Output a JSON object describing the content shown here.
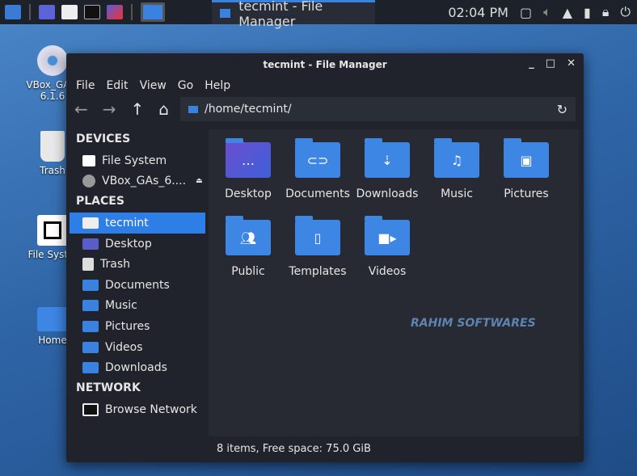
{
  "panel": {
    "task_title": "tecmint - File Manager",
    "clock": "02:04 PM"
  },
  "desktop": {
    "icons": [
      {
        "label": "VBox_GA...",
        "sub": "6.1.6"
      },
      {
        "label": "Trash"
      },
      {
        "label": "File Syst..."
      },
      {
        "label": "Home"
      }
    ]
  },
  "window": {
    "title": "tecmint - File Manager",
    "controls": [
      "_",
      "□",
      "✕"
    ],
    "menu": [
      "File",
      "Edit",
      "View",
      "Go",
      "Help"
    ],
    "address": "/home/tecmint/",
    "sidebar": {
      "devices_header": "DEVICES",
      "devices": [
        "File System",
        "VBox_GAs_6...."
      ],
      "places_header": "PLACES",
      "places": [
        "tecmint",
        "Desktop",
        "Trash",
        "Documents",
        "Music",
        "Pictures",
        "Videos",
        "Downloads"
      ],
      "network_header": "NETWORK",
      "network": [
        "Browse Network"
      ]
    },
    "files": [
      "Desktop",
      "Documents",
      "Downloads",
      "Music",
      "Pictures",
      "Public",
      "Templates",
      "Videos"
    ],
    "status": "8 items, Free space: 75.0 GiB"
  },
  "watermark": "RAHIM SOFTWARES"
}
